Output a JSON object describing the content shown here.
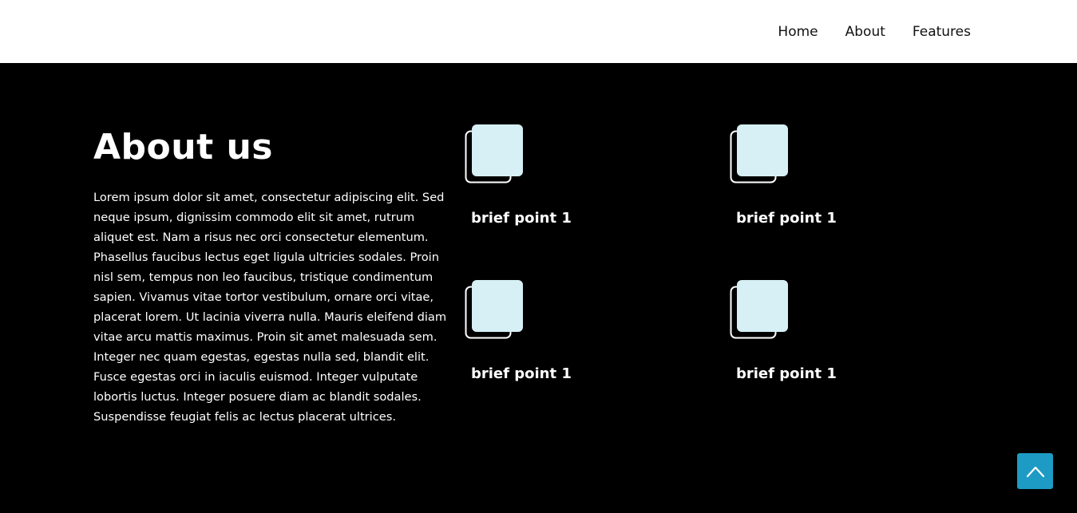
{
  "nav": {
    "items": [
      {
        "label": "Home"
      },
      {
        "label": "About"
      },
      {
        "label": "Features"
      }
    ]
  },
  "about": {
    "title": "About us",
    "body": "Lorem ipsum dolor sit amet, consectetur adipiscing elit. Sed neque ipsum, dignissim commodo elit sit amet, rutrum aliquet est. Nam a risus nec orci consectetur elementum. Phasellus faucibus lectus eget ligula ultricies sodales. Proin nisl sem, tempus non leo faucibus, tristique condimentum sapien. Vivamus vitae tortor vestibulum, ornare orci vitae, placerat lorem. Ut lacinia viverra nulla. Mauris eleifend diam vitae arcu mattis maximus. Proin sit amet malesuada sem. Integer nec quam egestas, egestas nulla sed, blandit elit. Fusce egestas orci in iaculis euismod. Integer vulputate lobortis luctus. Integer posuere diam ac blandit sodales. Suspendisse feugiat felis ac lectus placerat ultrices."
  },
  "points": [
    {
      "label": "brief point 1",
      "icon": "stacked-cards-icon"
    },
    {
      "label": "brief point 1",
      "icon": "stacked-cards-icon"
    },
    {
      "label": "brief point 1",
      "icon": "stacked-cards-icon"
    },
    {
      "label": "brief point 1",
      "icon": "stacked-cards-icon"
    }
  ],
  "scroll_top": {
    "icon": "chevron-up-icon"
  },
  "colors": {
    "background": "#000000",
    "navbar": "#ffffff",
    "icon_fill": "#d6f0f5",
    "accent": "#1e9bc4"
  }
}
